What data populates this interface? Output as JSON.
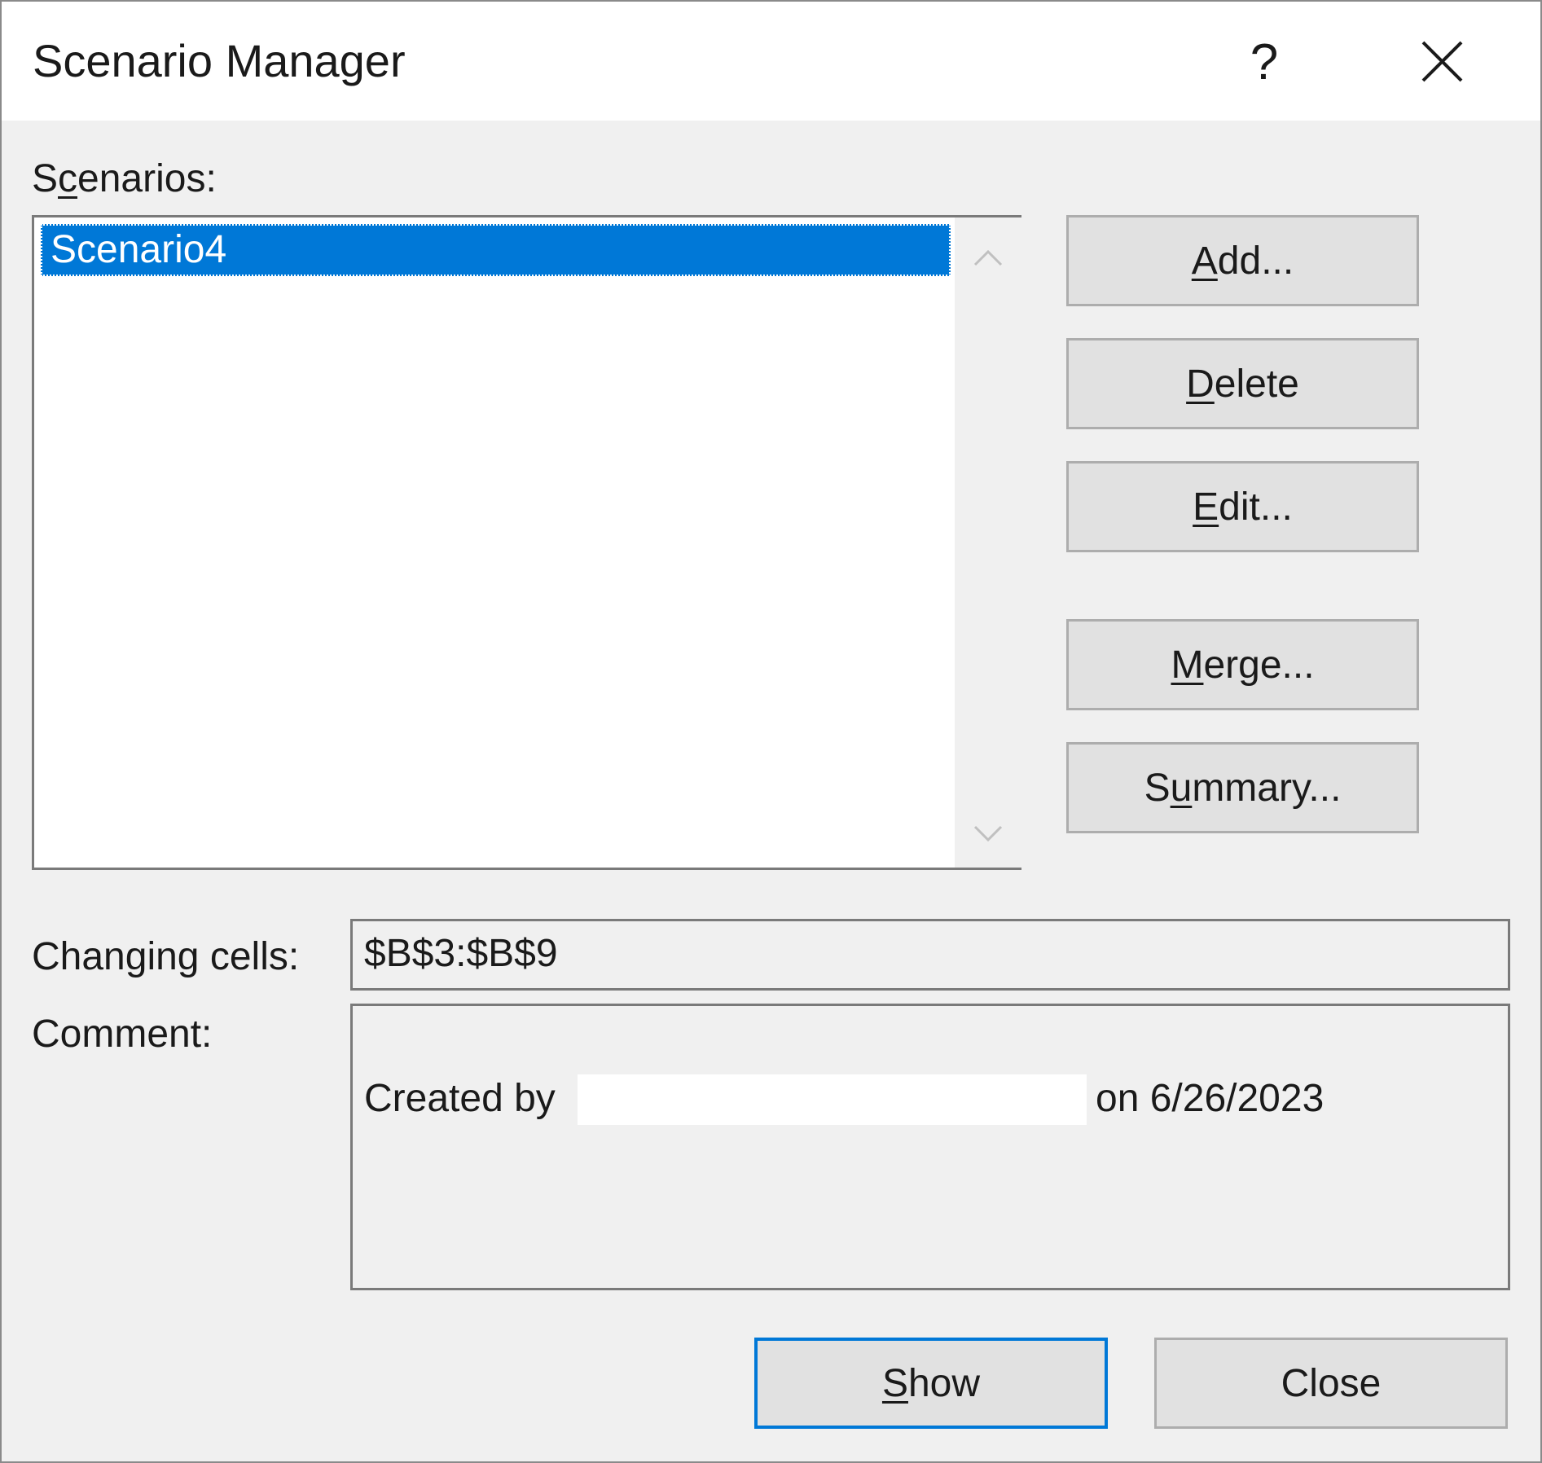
{
  "window": {
    "title": "Scenario Manager",
    "help_glyph": "?",
    "close_icon": "close-icon"
  },
  "scenarios": {
    "label_pre": "S",
    "label_ul": "c",
    "label_post": "enarios:",
    "items": [
      "Scenario4"
    ],
    "selected": "Scenario4"
  },
  "buttons": {
    "add": {
      "ul": "A",
      "rest": "dd..."
    },
    "delete": {
      "ul": "D",
      "rest": "elete"
    },
    "edit": {
      "ul": "E",
      "rest": "dit..."
    },
    "merge": {
      "ul": "M",
      "rest": "erge..."
    },
    "summary": {
      "pre": "S",
      "ul": "u",
      "rest": "mmary..."
    },
    "show": {
      "ul": "S",
      "rest": "how"
    },
    "close": "Close"
  },
  "changing_cells": {
    "label": "Changing cells:",
    "value": "$B$3:$B$9"
  },
  "comment": {
    "label": "Comment:",
    "prefix": "Created by",
    "suffix": "on 6/26/2023"
  },
  "colors": {
    "selection": "#0078d7",
    "default_button_border": "#0078d7"
  }
}
